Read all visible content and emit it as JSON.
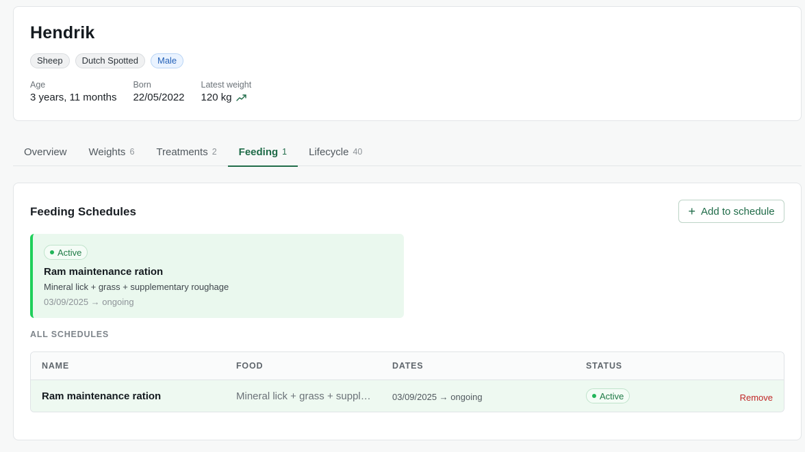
{
  "animal": {
    "name": "Hendrik",
    "species": "Sheep",
    "breed": "Dutch Spotted",
    "sex": "Male",
    "stats": {
      "age_label": "Age",
      "age_value": "3 years, 11 months",
      "born_label": "Born",
      "born_value": "22/05/2022",
      "weight_label": "Latest weight",
      "weight_value": "120 kg"
    }
  },
  "tabs": [
    {
      "label": "Overview",
      "count": ""
    },
    {
      "label": "Weights",
      "count": "6"
    },
    {
      "label": "Treatments",
      "count": "2"
    },
    {
      "label": "Feeding",
      "count": "1"
    },
    {
      "label": "Lifecycle",
      "count": "40"
    }
  ],
  "feeding": {
    "title": "Feeding Schedules",
    "add_button": "Add to schedule",
    "active_card": {
      "status": "Active",
      "name": "Ram maintenance ration",
      "food": "Mineral lick + grass + supplementary roughage",
      "dates": "03/09/2025 → ongoing"
    },
    "all_label": "ALL SCHEDULES",
    "table": {
      "headers": [
        "NAME",
        "FOOD",
        "DATES",
        "STATUS"
      ],
      "rows": [
        {
          "name": "Ram maintenance ration",
          "food": "Mineral lick + grass + supple…",
          "dates": "03/09/2025 → ongoing",
          "status": "Active",
          "action": "Remove"
        }
      ]
    }
  },
  "colors": {
    "accent": "#1f6b48",
    "active_bar": "#1fcf5a",
    "active_bg": "#eaf8ee",
    "remove": "#c02626"
  }
}
